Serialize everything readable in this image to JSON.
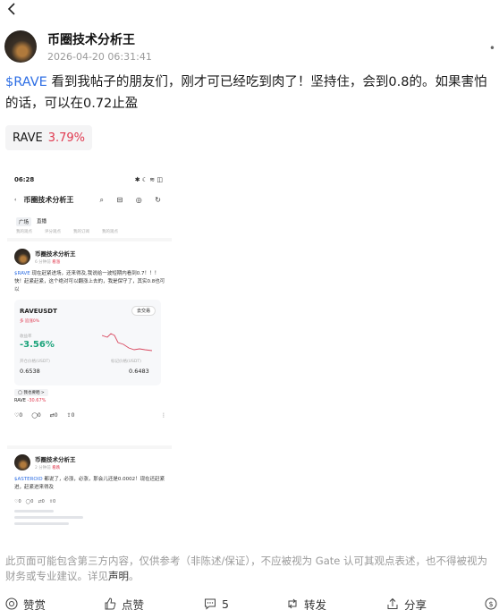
{
  "post": {
    "author": "币圈技术分析王",
    "time": "2026-04-20 06:31:41",
    "text_tag": "$RAVE",
    "text_body": " 看到我帖子的朋友们，刚才可已经吃到肉了！坚持住，会到0.8的。如果害怕的话，可以在0.72止盈",
    "coin_symbol": "RAVE",
    "coin_change": "3.79%"
  },
  "shot": {
    "status_time": "06:28",
    "status_icons": "✱ ☾ ≋ ◫",
    "nav_title": "币圈技术分析王",
    "nav_icons": "⌕ ⊟ ◎ ↻",
    "tabs": [
      "广场",
      "直播"
    ],
    "subtabs": [
      "我的观点",
      "评分观点",
      "我的订阅",
      "我的观点"
    ],
    "post1": {
      "author": "币圈技术分析王",
      "time": "6 分钟前",
      "badge": "看涨",
      "tag": "$RAVE",
      "text": " 现在赶紧进场，还来得及,我说给一波短期内看到0.7！！！快！赶紧赶紧，这个绝对可以翻涨上去的，我是保守了，其实0.8也可以",
      "card": {
        "pair": "RAVEUSDT",
        "button": "去交易",
        "tagline": "多  追涨0%",
        "change_label": "收益率",
        "change": "-3.56%",
        "open_label": "开仓价格(USDT)",
        "open": "0.6538",
        "mark_label": "标记价格(USDT)",
        "mark": "0.6483"
      },
      "chip1": "◯ 我也要晒 >",
      "chip2_symbol": "RAVE",
      "chip2_change": "-30.67%",
      "actions": [
        "♡0",
        "◯0",
        "⇄0",
        "⇪0"
      ],
      "dots": "⋮"
    },
    "post2": {
      "author": "币圈技术分析王",
      "time": "2 分钟前",
      "badge": "看跌",
      "tag": "$ASTEROID",
      "text": " 都说了，必涨，必涨，那会儿还是0.0002！现在还赶紧进，赶紧进来得及",
      "thumbs": [
        "♡0",
        "◯0",
        "⇄0",
        "⇪0"
      ]
    }
  },
  "disclaimer": {
    "text": "此页面可能包含第三方内容，仅供参考（非陈述/保证），不应被视为 Gate 认可其观点表述，也不得被视为财务或专业建议。详见",
    "link": "声明",
    "end": "。"
  },
  "bottom_bar": {
    "tip": "赞赏",
    "like": "点赞",
    "comments": "5",
    "repost": "转发",
    "share": "分享"
  }
}
